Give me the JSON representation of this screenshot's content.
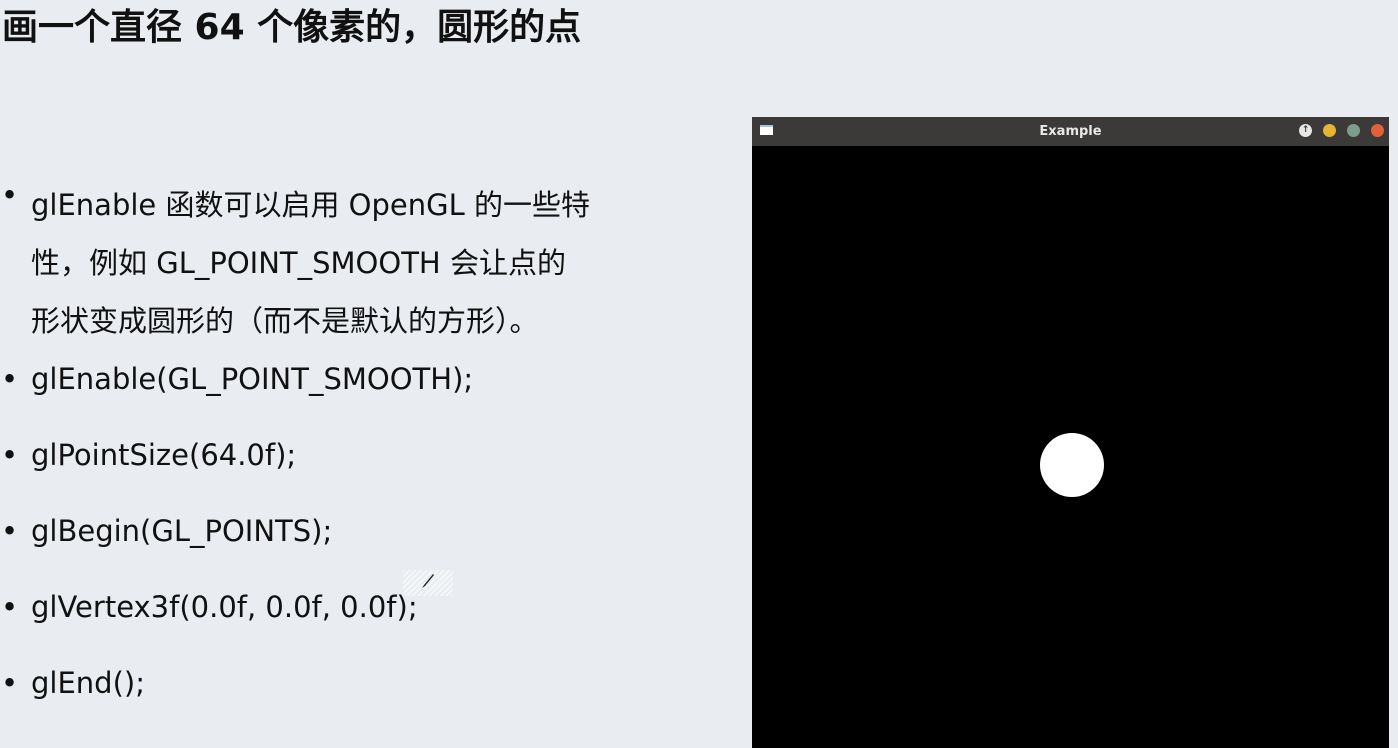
{
  "slide": {
    "title": "画一个直径 64 个像素的，圆形的点",
    "intro_lines": [
      "glEnable 函数可以启用 OpenGL 的一些特",
      "性，例如 GL_POINT_SMOOTH 会让点的",
      "形状变成圆形的（而不是默认的方形）。"
    ],
    "code_lines": [
      "glEnable(GL_POINT_SMOOTH);",
      "glPointSize(64.0f);",
      "glBegin(GL_POINTS);",
      "glVertex3f(0.0f, 0.0f, 0.0f);",
      "glEnd();"
    ]
  },
  "window": {
    "title": "Example",
    "icon": "window-app-icon",
    "buttons": [
      "restore-icon",
      "minimize-icon",
      "maximize-icon",
      "close-icon"
    ],
    "button_colors": {
      "restore": "#e6e6e6",
      "minimize": "#e7b432",
      "maximize": "#7c9d8d",
      "close": "#e2603c"
    },
    "titlebar_color": "#3c3a38",
    "canvas_color": "#000000",
    "point_color": "#ffffff"
  },
  "colors": {
    "slide_background": "#e9ecf0",
    "text": "#111111"
  }
}
